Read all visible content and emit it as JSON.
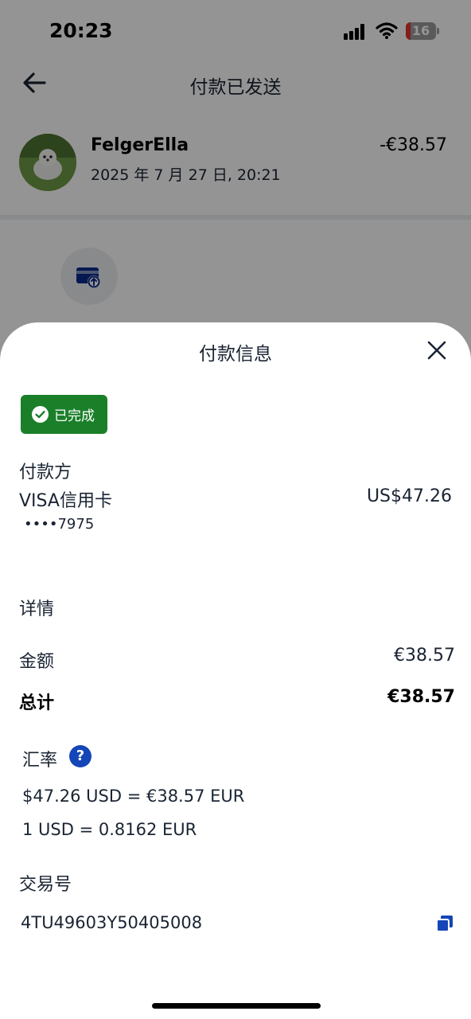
{
  "status_bar": {
    "time": "20:23",
    "battery": "16"
  },
  "header": {
    "title": "付款已发送"
  },
  "transaction": {
    "payee_name": "FelgerElla",
    "date": "2025 年 7 月 27 日, 20:21",
    "amount": "-€38.57"
  },
  "sheet": {
    "title": "付款信息",
    "status_badge": "已完成",
    "payer": {
      "label": "付款方",
      "method": "VISA信用卡",
      "card_number": "••••7975",
      "amount": "US$47.26"
    },
    "details": {
      "label": "详情",
      "amount_label": "金额",
      "amount_value": "€38.57",
      "total_label": "总计",
      "total_value": "€38.57"
    },
    "exchange": {
      "label": "汇率",
      "help_glyph": "?",
      "conversion": "$47.26 USD = €38.57 EUR",
      "rate": "1 USD = 0.8162 EUR"
    },
    "transaction_id": {
      "label": "交易号",
      "value": "4TU49603Y50405008"
    }
  },
  "colors": {
    "accent_blue": "#1546b7",
    "success_green": "#1b7f2a",
    "text_dark": "#1a2433"
  },
  "icons": [
    "back-arrow-icon",
    "close-icon",
    "check-circle-icon",
    "help-icon",
    "copy-icon",
    "wifi-icon",
    "signal-icon",
    "battery-icon",
    "payment-sent-icon"
  ]
}
